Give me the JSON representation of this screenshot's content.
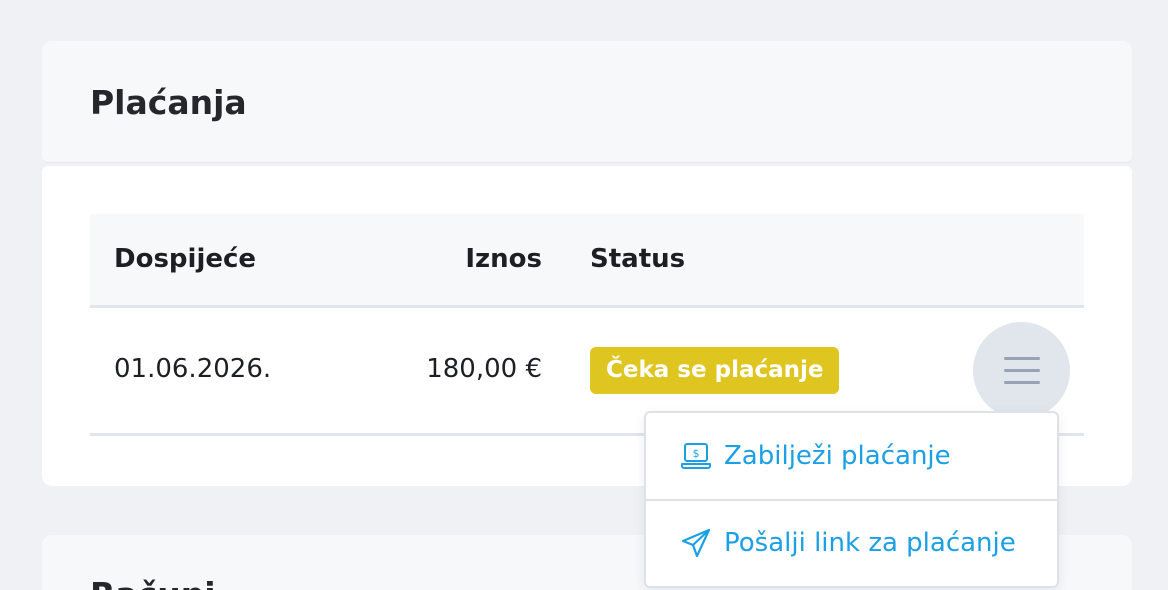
{
  "payments": {
    "title": "Plaćanja",
    "table": {
      "headers": {
        "due": "Dospijeće",
        "amount": "Iznos",
        "status": "Status"
      },
      "rows": [
        {
          "due": "01.06.2026.",
          "amount": "180,00 €",
          "status": "Čeka se plaćanje",
          "status_color": "#dfc51f"
        }
      ]
    },
    "row_menu": {
      "icon": "hamburger-menu-icon",
      "items": [
        {
          "label": "Zabilježi plaćanje",
          "icon": "payment-record-icon"
        },
        {
          "label": "Pošalji link za plaćanje",
          "icon": "paper-plane-icon"
        }
      ]
    }
  },
  "next_section": {
    "title": "Računi"
  },
  "colors": {
    "accent": "#1ba0e6",
    "pending": "#dfc51f",
    "background": "#f0f1f4"
  }
}
